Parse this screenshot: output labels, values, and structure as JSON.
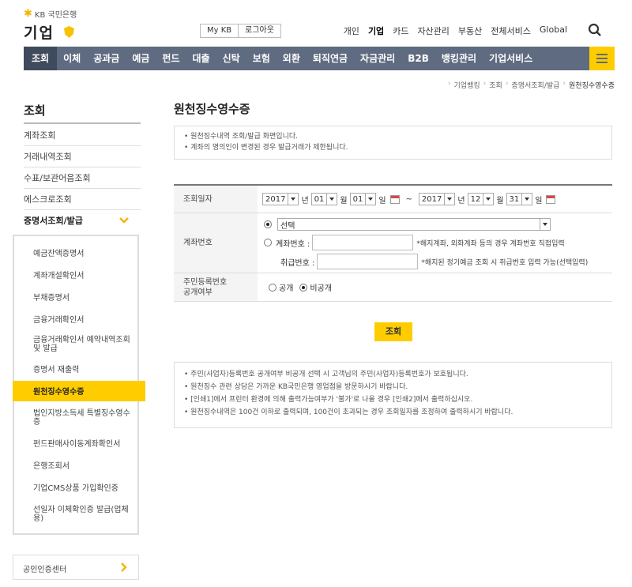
{
  "logo": {
    "top_text": "KB 국민은행",
    "main_text": "기업"
  },
  "top_buttons": [
    "My KB",
    "로그아웃"
  ],
  "top_nav": [
    {
      "label": "개인",
      "active": false
    },
    {
      "label": "기업",
      "active": true
    },
    {
      "label": "카드",
      "active": false
    },
    {
      "label": "자산관리",
      "active": false
    },
    {
      "label": "부동산",
      "active": false
    },
    {
      "label": "전체서비스",
      "active": false
    },
    {
      "label": "Global",
      "active": false
    }
  ],
  "main_nav": [
    "조회",
    "이체",
    "공과금",
    "예금",
    "펀드",
    "대출",
    "신탁",
    "보험",
    "외환",
    "퇴직연금",
    "자금관리",
    "B2B",
    "뱅킹관리",
    "기업서비스"
  ],
  "breadcrumb": [
    "기업뱅킹",
    "조회",
    "증명서조회/발급",
    "원천징수영수증"
  ],
  "sidebar": {
    "title": "조회",
    "items": [
      "계좌조회",
      "거래내역조회",
      "수표/보관어음조회",
      "에스크로조회",
      "증명서조회/발급"
    ],
    "sub_items": [
      "예금잔액증명서",
      "계좌개설확인서",
      "부채증명서",
      "금융거래확인서",
      "금융거래확인서 예약내역조회 및 발급",
      "증명서 재출력",
      "원천징수영수증",
      "법인지방소득세 특별징수영수증",
      "펀드판매사이동계좌확인서",
      "은행조회서",
      "기업CMS상품 가입확인증",
      "선일자 이체확인증 발급(업체용)"
    ],
    "active_sub": "원천징수영수증",
    "cert_center": "공인인증센터"
  },
  "page": {
    "title": "원천징수영수증",
    "notices": [
      "원천징수내역 조회/발급 화면입니다.",
      "계좌의 명의인이 변경된 경우 발급거래가 제한됩니다."
    ]
  },
  "form": {
    "date_label": "조회일자",
    "from": {
      "year": "2017",
      "month": "01",
      "day": "01"
    },
    "to": {
      "year": "2017",
      "month": "12",
      "day": "31"
    },
    "unit_year": "년",
    "unit_month": "월",
    "unit_day": "일",
    "tilde": "~",
    "account_label": "계좌번호",
    "account_select": "선택",
    "account_no_label": "계좌번호 :",
    "account_hint": "*해지계좌, 외화계좌 등의 경우 계좌번호 직접입력",
    "handle_no_label": "취급번호 :",
    "handle_hint": "*해지된 정기예금 조회 시 취급번호 입력 가능(선택입력)",
    "rrn_label_1": "주민등록번호",
    "rrn_label_2": "공개여부",
    "rrn_public": "공개",
    "rrn_private": "비공개",
    "submit": "조회"
  },
  "notes": [
    "주민(사업자)등록번호 공개여부 비공개 선택 시 고객님의 주민(사업자)등록번호가 보호됩니다.",
    "원천징수 관련 상담은 가까운 KB국민은행 영업점을 방문하시기 바랍니다.",
    "[인쇄1]에서 프린터 환경에 의해 출력가능여부가 '불가'로 나올 경우 [인쇄2]에서 출력하십시오.",
    "원천징수내역은 100건 이하로 출력되며, 100건이 초과되는 경우 조회일자를 조정하여 출력하시기 바랍니다."
  ],
  "icons": {
    "search": "search-icon",
    "menu": "hamburger-menu-icon",
    "calendar": "calendar-icon"
  },
  "colors": {
    "accent": "#ffcc00",
    "nav_bg": "#5f6b80"
  }
}
